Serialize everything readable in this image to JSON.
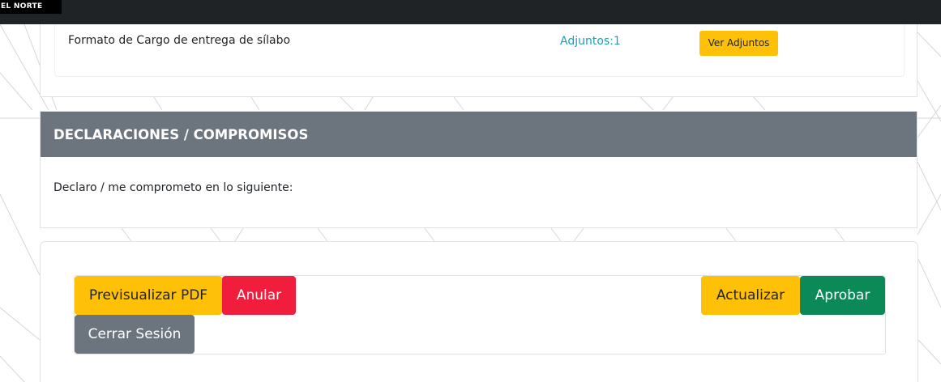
{
  "topbar": {
    "brand_text": "EL NORTE"
  },
  "attachments": {
    "item_name": "Formato de Cargo de entrega de sílabo",
    "attachments_link": "Adjuntos:1",
    "view_button": "Ver Adjuntos"
  },
  "declarations": {
    "header": "DECLARACIONES / COMPROMISOS",
    "intro": "Declaro / me comprometo en lo siguiente:"
  },
  "actions": {
    "preview_pdf": "Previsualizar PDF",
    "cancel": "Anular",
    "update": "Actualizar",
    "approve": "Aprobar",
    "logout": "Cerrar Sesión"
  },
  "colors": {
    "topbar": "#1f2326",
    "header_gray": "#6c757d",
    "warning_yellow": "#ffc107",
    "danger_red": "#f01e3c",
    "success_green": "#0b8a57",
    "info_link": "#17a2b8"
  }
}
